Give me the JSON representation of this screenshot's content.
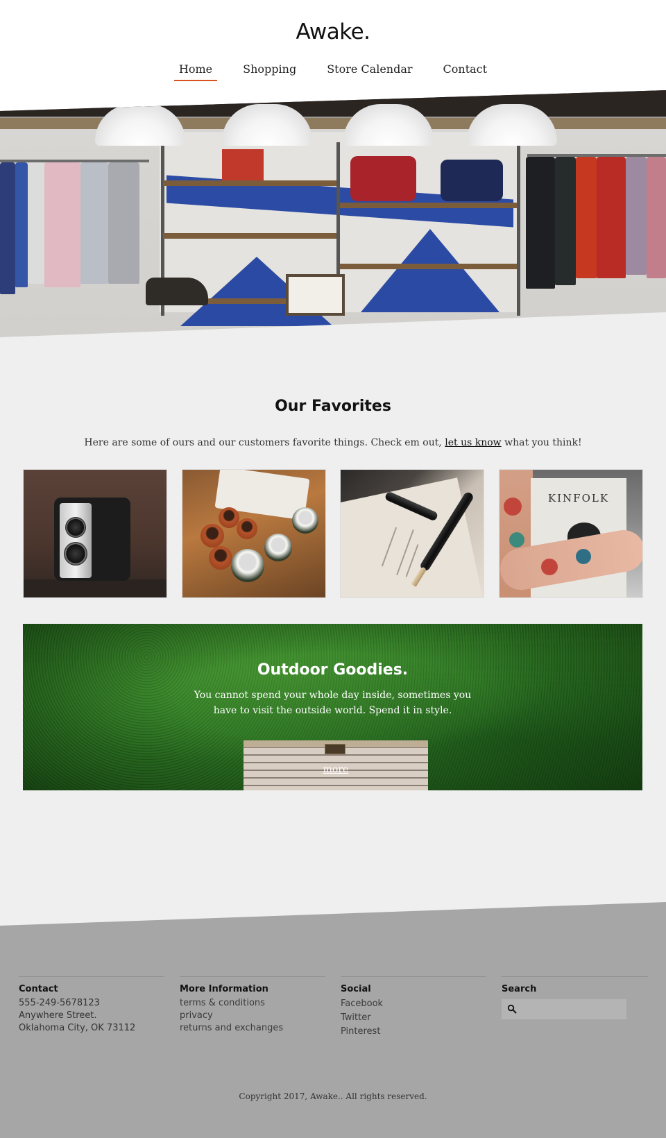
{
  "site": {
    "logo": "Awake."
  },
  "nav": {
    "items": [
      {
        "label": "Home",
        "active": true
      },
      {
        "label": "Shopping",
        "active": false
      },
      {
        "label": "Store Calendar",
        "active": false
      },
      {
        "label": "Contact",
        "active": false
      }
    ]
  },
  "favorites": {
    "title": "Our Favorites",
    "intro_before": "Here are some of ours and our customers favorite things. Check em out, ",
    "intro_link": "let us know",
    "intro_after": " what you think!",
    "thumbs": [
      {
        "subject": "camera"
      },
      {
        "subject": "mugs"
      },
      {
        "subject": "fountain-pen"
      },
      {
        "subject": "magazine",
        "text": "KINFOLK"
      }
    ]
  },
  "banner": {
    "title": "Outdoor Goodies.",
    "text": "You cannot spend your whole day inside, sometimes you have to visit the outside world. Spend it in style.",
    "more_label": "more"
  },
  "footer": {
    "contact": {
      "heading": "Contact",
      "phone": "555-249-5678123",
      "street": "Anywhere Street.",
      "city": "Oklahoma City, OK 73112"
    },
    "more_info": {
      "heading": "More Information",
      "links": [
        "terms & conditions",
        "privacy",
        "returns and exchanges"
      ]
    },
    "social": {
      "heading": "Social",
      "links": [
        "Facebook",
        "Twitter",
        "Pinterest"
      ]
    },
    "search": {
      "heading": "Search",
      "placeholder": "",
      "icon": "search-icon"
    },
    "copyright": "Copyright 2017, Awake.. All rights reserved."
  },
  "colors": {
    "accent": "#d9541e",
    "footer_bg": "#a5a6a5",
    "page_bg": "#efefef"
  }
}
